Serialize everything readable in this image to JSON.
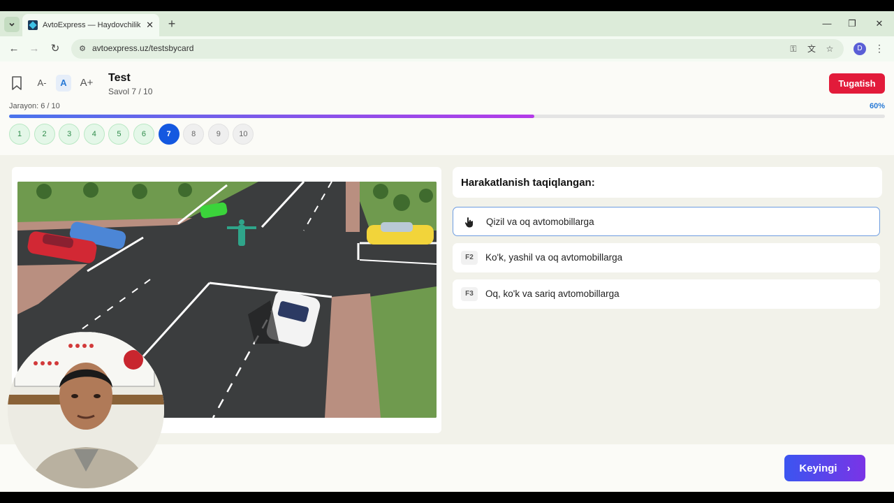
{
  "browser": {
    "tab_title": "AvtoExpress — Haydovchilik Te",
    "url": "avtoexpress.uz/testsbycard",
    "profile_initial": "D"
  },
  "header": {
    "font_small": "A-",
    "font_normal": "A",
    "font_large": "A+",
    "title": "Test",
    "subtitle": "Savol 7 / 10",
    "finish_label": "Tugatish",
    "progress_label": "Jarayon: 6 / 10",
    "progress_percent_label": "60%",
    "progress_value": 0.6
  },
  "question_nav": [
    {
      "label": "1",
      "state": "answered"
    },
    {
      "label": "2",
      "state": "answered"
    },
    {
      "label": "3",
      "state": "answered"
    },
    {
      "label": "4",
      "state": "answered"
    },
    {
      "label": "5",
      "state": "answered"
    },
    {
      "label": "6",
      "state": "answered"
    },
    {
      "label": "7",
      "state": "current"
    },
    {
      "label": "8",
      "state": "pending"
    },
    {
      "label": "9",
      "state": "pending"
    },
    {
      "label": "10",
      "state": "pending"
    }
  ],
  "question": {
    "text": "Harakatlanish taqiqlangan:",
    "answers": [
      {
        "key": "F1",
        "text": "Qizil va oq avtomobillarga",
        "selected": true
      },
      {
        "key": "F2",
        "text": "Ko'k, yashil va oq avtomobillarga",
        "selected": false
      },
      {
        "key": "F3",
        "text": "Oq, ko'k va sariq avtomobillarga",
        "selected": false
      }
    ]
  },
  "footer": {
    "next_label": "Keyingi"
  },
  "colors": {
    "accent": "#1458e0",
    "finish": "#e21b3a",
    "answered": "#e4f7e8"
  }
}
